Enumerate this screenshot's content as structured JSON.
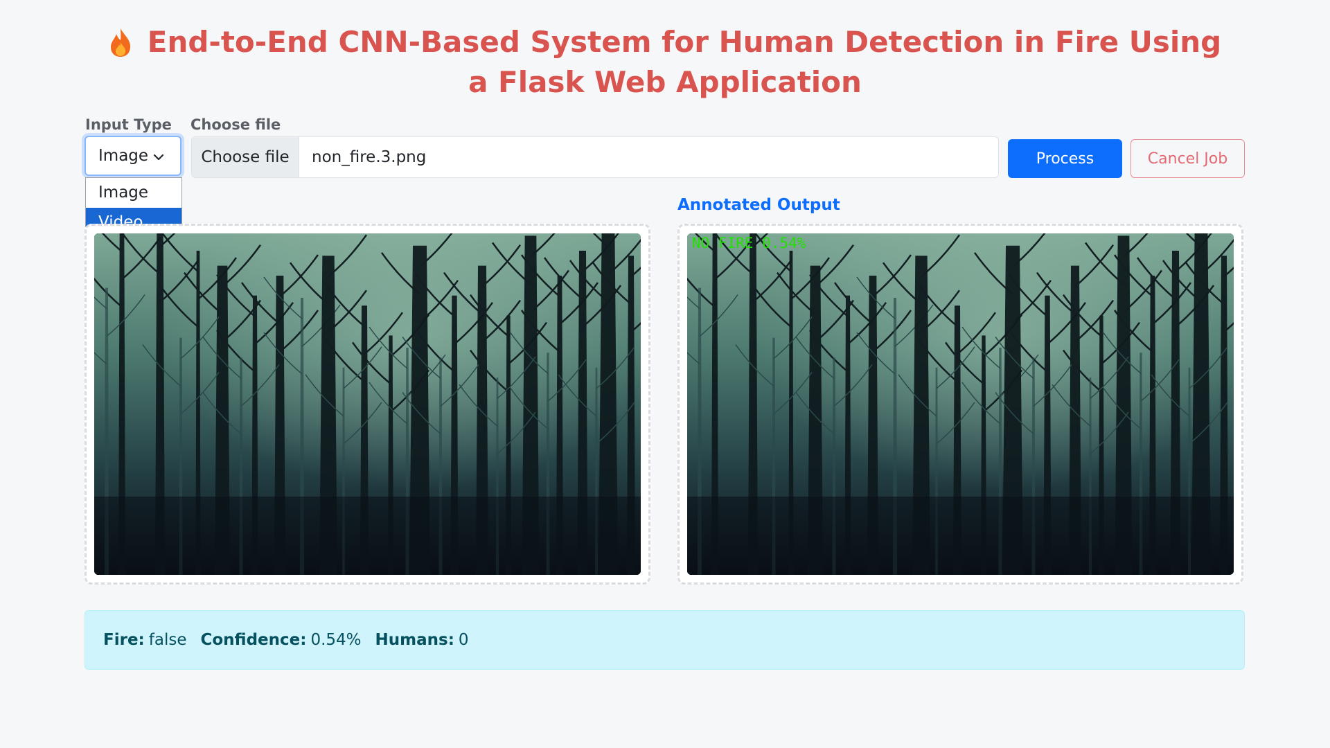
{
  "header": {
    "title": "End-to-End CNN-Based System for Human Detection in Fire Using a Flask Web Application",
    "icon": "fire-icon"
  },
  "form": {
    "input_type_label": "Input Type",
    "input_type_value": "Image",
    "input_type_options": [
      "Image",
      "Video"
    ],
    "highlighted_option": "Video",
    "file_label": "Choose file",
    "file_button": "Choose file",
    "file_name": "non_fire.3.png",
    "process_label": "Process",
    "cancel_label": "Cancel Job"
  },
  "panes": {
    "output_title": "Annotated Output",
    "overlay_text": "NO FIRE 0.54%"
  },
  "result": {
    "fire_label": "Fire:",
    "fire_value": "false",
    "confidence_label": "Confidence:",
    "confidence_value": "0.54%",
    "humans_label": "Humans:",
    "humans_value": "0"
  },
  "colors": {
    "title": "#d9534f",
    "primary": "#0d6efd",
    "danger": "#dc3545",
    "info_bg": "#cff4fc",
    "overlay_green": "#22e000"
  }
}
